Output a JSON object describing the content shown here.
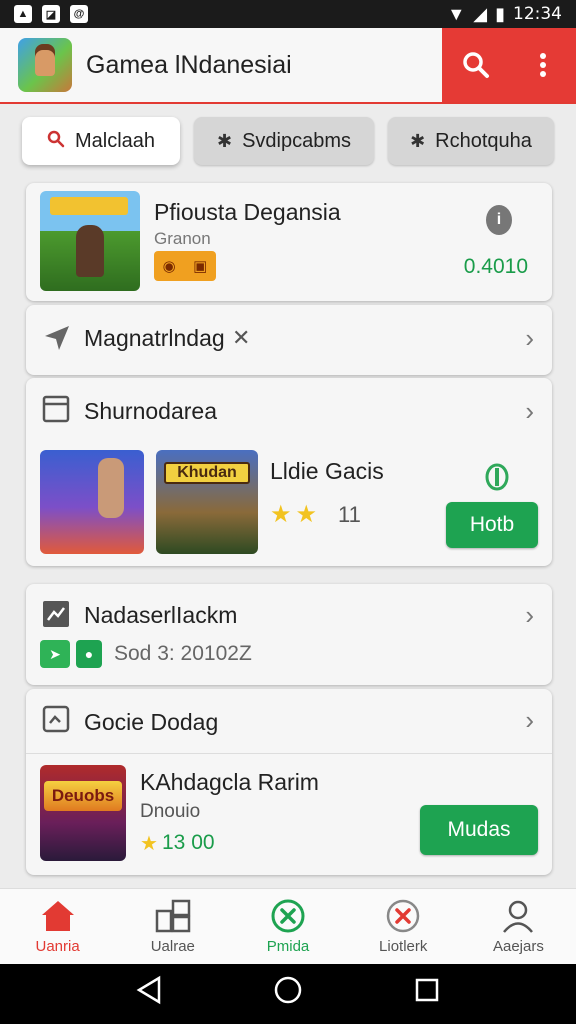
{
  "status_bar": {
    "time": "12:34"
  },
  "app_bar": {
    "title": "Gamea lNdanesiai"
  },
  "chips": [
    {
      "label": "Malclaah"
    },
    {
      "label": "Svdipcabms"
    },
    {
      "label": "Rchotquha"
    }
  ],
  "featured": {
    "title": "Pfiousta Degansia",
    "subtitle": "Granon",
    "value": "0.4010"
  },
  "row_nav": {
    "label": "Magnatrlndag"
  },
  "section_games": {
    "title": "Shurnodarea",
    "thumb_label": "Khudan",
    "game_title": "Lldie Gacis",
    "rating_value": "11",
    "button": "Hotb"
  },
  "row_news": {
    "title": "NadaserlIackm",
    "value": "Sod 3: 20102Z"
  },
  "section_google": {
    "title": "Gocie Dodag",
    "thumb_label": "Deuobs",
    "game_title": "KAhdagcla Rarim",
    "subtitle": "Dnouio",
    "rating_value": "13 00",
    "button": "Mudas"
  },
  "bottom_nav": [
    {
      "label": "Uanria",
      "icon": "home-icon",
      "color": "#e23a33"
    },
    {
      "label": "Ualrae",
      "icon": "apps-icon",
      "color": "#555555"
    },
    {
      "label": "Pmida",
      "icon": "close-circle-icon",
      "color": "#1ea351"
    },
    {
      "label": "Liotlerk",
      "icon": "close-circle-icon",
      "color": "#e23a33"
    },
    {
      "label": "Aaejars",
      "icon": "person-icon",
      "color": "#555555"
    }
  ],
  "colors": {
    "accent": "#e53a35",
    "green": "#1ea351"
  }
}
